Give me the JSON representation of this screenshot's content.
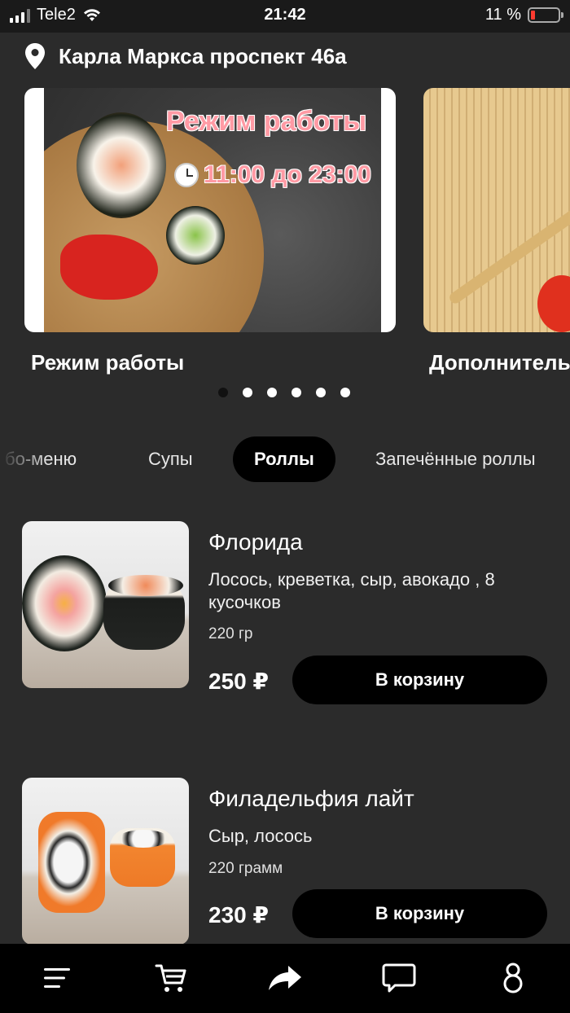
{
  "status_bar": {
    "carrier": "Tele2",
    "time": "21:42",
    "battery_percent": "11 %",
    "battery_level": 0.11,
    "battery_color": "#ff3b30"
  },
  "header": {
    "address": "Карла Маркса проспект 46а",
    "icon": "location-pin-icon"
  },
  "carousel": {
    "banners": [
      {
        "image_text_title": "Режим работы",
        "image_text_hours": "11:00 до 23:00",
        "caption": "Режим работы"
      },
      {
        "caption": "Дополнитель"
      }
    ],
    "pages": 6,
    "active_page": 1
  },
  "category_tabs": {
    "items": [
      "бо-меню",
      "Супы",
      "Роллы",
      "Запечённые роллы"
    ],
    "active": "Роллы"
  },
  "products": [
    {
      "name": "Флорида",
      "description": "Лосось, креветка, сыр, авокадо , 8 кусочков",
      "weight": "220 гр",
      "price": "250 ₽",
      "button": "В корзину"
    },
    {
      "name": "Филадельфия лайт",
      "description": "Сыр, лосось",
      "weight": "220 грамм",
      "price": "230 ₽",
      "button": "В корзину"
    }
  ],
  "tab_bar": {
    "items": [
      "menu-icon",
      "cart-icon",
      "share-icon",
      "chat-icon",
      "profile-icon"
    ]
  },
  "colors": {
    "background": "#2b2b2b",
    "button": "#000000",
    "banner_text": "#ff9aa4"
  }
}
